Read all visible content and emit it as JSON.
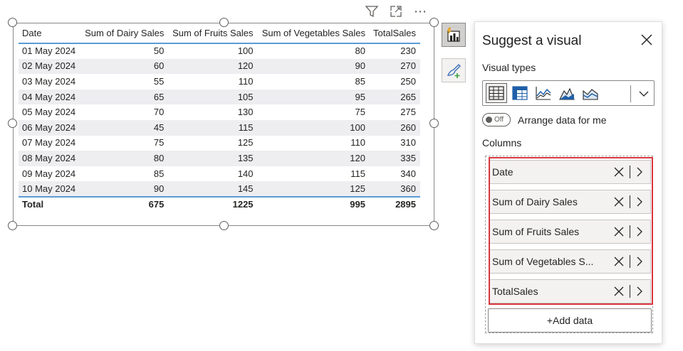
{
  "visual_toolbar": {
    "icons": [
      "filter-icon",
      "focus-mode-icon",
      "more-options-icon"
    ],
    "more_label": "⋯"
  },
  "table": {
    "headers": [
      "Date",
      "Sum of Dairy Sales",
      "Sum of Fruits Sales",
      "Sum of Vegetables Sales",
      "TotalSales"
    ],
    "rows": [
      [
        "01 May 2024",
        "50",
        "100",
        "80",
        "230"
      ],
      [
        "02 May 2024",
        "60",
        "120",
        "90",
        "270"
      ],
      [
        "03 May 2024",
        "55",
        "110",
        "85",
        "250"
      ],
      [
        "04 May 2024",
        "65",
        "105",
        "95",
        "265"
      ],
      [
        "05 May 2024",
        "70",
        "130",
        "75",
        "275"
      ],
      [
        "06 May 2024",
        "45",
        "115",
        "100",
        "260"
      ],
      [
        "07 May 2024",
        "75",
        "125",
        "110",
        "310"
      ],
      [
        "08 May 2024",
        "80",
        "135",
        "120",
        "335"
      ],
      [
        "09 May 2024",
        "85",
        "140",
        "115",
        "340"
      ],
      [
        "10 May 2024",
        "90",
        "145",
        "125",
        "360"
      ]
    ],
    "total": [
      "Total",
      "675",
      "1225",
      "995",
      "2895"
    ],
    "header_rule_color": "#5b9bd5",
    "alt_row_color": "#eeedf0"
  },
  "side_buttons": [
    "suggest-visual-icon",
    "format-visual-icon"
  ],
  "panel": {
    "title": "Suggest a visual",
    "visual_types_label": "Visual types",
    "visual_type_icons": [
      "table-icon",
      "matrix-icon",
      "line-chart-icon",
      "area-chart-icon",
      "stacked-area-icon"
    ],
    "toggle_state": "Off",
    "arrange_label": "Arrange data for me",
    "columns_label": "Columns",
    "columns": [
      "Date",
      "Sum of Dairy Sales",
      "Sum of Fruits Sales",
      "Sum of Vegetables S...",
      "TotalSales"
    ],
    "add_data_label": "+Add data",
    "highlight_color": "#d9363e"
  }
}
